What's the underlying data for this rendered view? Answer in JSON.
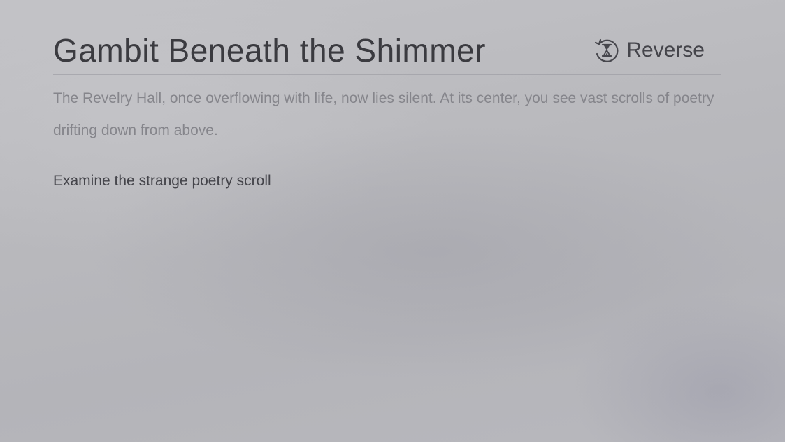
{
  "scene": {
    "title": "Gambit Beneath the Shimmer",
    "reverse_button": {
      "label": "Reverse",
      "icon": "hourglass-rewind-icon"
    },
    "description": "The Revelry Hall, once overflowing with life, now lies silent. At its center, you see vast scrolls of poetry drifting down from above.",
    "choices": [
      {
        "label": "Examine the strange poetry scroll"
      }
    ]
  },
  "colors": {
    "background": "#bcbcc0",
    "title_text": "#3b3b40",
    "description_text": "#85858b",
    "choice_text": "#44444a"
  }
}
